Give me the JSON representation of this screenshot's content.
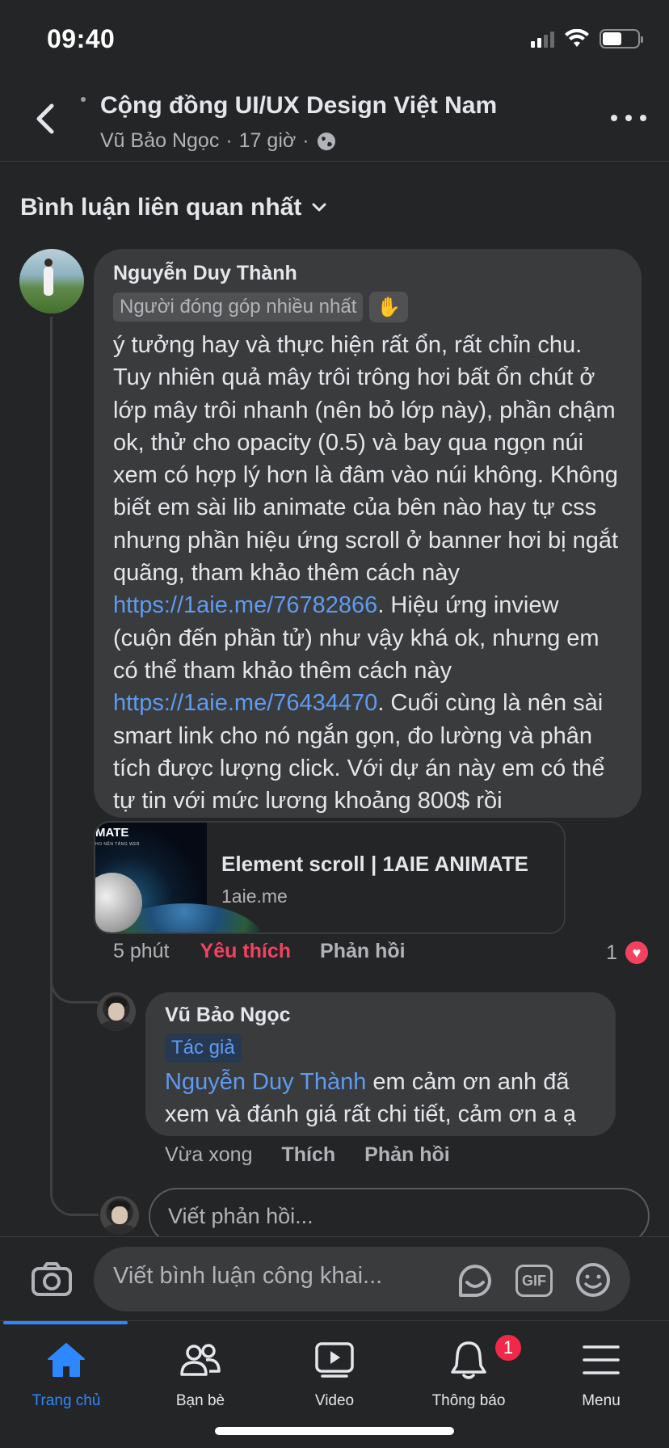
{
  "status_bar": {
    "time": "09:40"
  },
  "header": {
    "group_name": "Cộng đồng UI/UX Design Việt Nam",
    "author": "Vũ Bảo Ngọc",
    "time": "17 giờ",
    "separator": "·"
  },
  "sort": {
    "label": "Bình luận liên quan nhất"
  },
  "comment": {
    "author": "Nguyễn Duy Thành",
    "badge": "Người đóng góp nhiều nhất",
    "text_1": "ý tưởng hay và thực hiện rất ổn, rất chỉn chu. Tuy nhiên quả mây trôi trông hơi bất ổn chút ở lớp mây trôi nhanh (nên bỏ lớp này), phần chậm ok, thử cho opacity (0.5) và bay qua ngọn núi xem có hợp lý hơn là đâm vào núi không. Không biết em sài lib animate của bên nào hay tự css nhưng phần hiệu ứng scroll ở banner hơi bị ngắt quãng, tham khảo thêm cách này ",
    "link_1": "https://1aie.me/76782866",
    "text_2": ". Hiệu ứng inview (cuộn đến phần tử) như vậy khá ok, nhưng em có thể tham khảo thêm cách này ",
    "link_2": "https://1aie.me/76434470",
    "text_3": ". Cuối cùng là nên sài smart link cho nó ngắn gọn, đo lường và phân tích được lượng click. Với dự án này em có thể tự tin với mức lương khoảng 800$ rồi",
    "preview": {
      "thumb_title": "MATE",
      "thumb_sub": "HO NÊN TẢNG WEB",
      "title": "Element scroll | 1AIE ANIMATE",
      "domain": "1aie.me"
    },
    "time": "5 phút",
    "like_label": "Yêu thích",
    "reply_label": "Phản hồi",
    "reaction_count": "1"
  },
  "reply": {
    "author": "Vũ Bảo Ngọc",
    "tag": "Tác giả",
    "mention": "Nguyễn Duy Thành",
    "text": " em cảm ơn anh đã xem và đánh giá rất chi tiết, cảm ơn a ạ",
    "time": "Vừa xong",
    "like_label": "Thích",
    "reply_label": "Phản hồi"
  },
  "write_reply": {
    "placeholder": "Viết phản hồi..."
  },
  "composer": {
    "placeholder": "Viết bình luận công khai..."
  },
  "tabs": [
    {
      "label": "Trang chủ",
      "icon": "home-icon",
      "active": true
    },
    {
      "label": "Bạn bè",
      "icon": "friends-icon"
    },
    {
      "label": "Video",
      "icon": "video-icon"
    },
    {
      "label": "Thông báo",
      "icon": "bell-icon",
      "badge": "1"
    },
    {
      "label": "Menu",
      "icon": "menu-icon"
    }
  ],
  "colors": {
    "background": "#242526",
    "bubble": "#3a3b3c",
    "link": "#5e9bf2",
    "liked": "#f3425f",
    "accent": "#2d88ff"
  }
}
